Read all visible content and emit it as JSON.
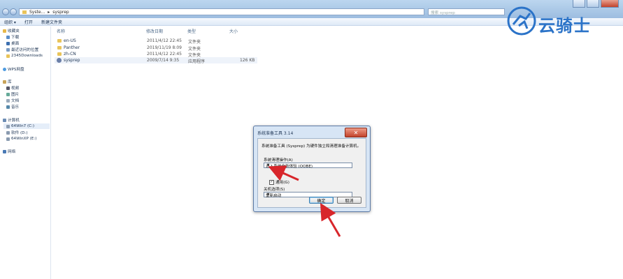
{
  "window": {
    "address": [
      "Syste...",
      "sysprep"
    ],
    "search_placeholder": "搜索 sysprep"
  },
  "toolbar": {
    "organize": "组织 ▾",
    "open": "打开",
    "new_folder": "新建文件夹"
  },
  "sidebar": {
    "items": [
      {
        "label": "收藏夹",
        "icon": "star-icon"
      },
      {
        "label": "下载",
        "icon": "download-folder-icon"
      },
      {
        "label": "桌面",
        "icon": "desktop-icon"
      },
      {
        "label": "最近访问的位置",
        "icon": "recent-places-icon"
      },
      {
        "label": "2345Downloads",
        "icon": "folder-icon"
      },
      {
        "label": "WPS网盘",
        "icon": "cloud-icon"
      },
      {
        "label": "库",
        "icon": "library-icon"
      },
      {
        "label": "视频",
        "icon": "video-icon"
      },
      {
        "label": "图片",
        "icon": "picture-icon"
      },
      {
        "label": "文档",
        "icon": "document-icon"
      },
      {
        "label": "音乐",
        "icon": "music-icon"
      },
      {
        "label": "计算机",
        "icon": "computer-icon"
      },
      {
        "label": "64Win7 (C:)",
        "icon": "drive-icon"
      },
      {
        "label": "软件 (D:)",
        "icon": "drive-icon"
      },
      {
        "label": "64WinXP (E:)",
        "icon": "drive-icon"
      },
      {
        "label": "网络",
        "icon": "network-icon"
      }
    ]
  },
  "filelist": {
    "columns": [
      "名称",
      "修改日期",
      "类型",
      "大小"
    ],
    "rows": [
      {
        "name": "en-US",
        "date": "2011/4/12 22:45",
        "type": "文件夹",
        "size": ""
      },
      {
        "name": "Panther",
        "date": "2019/11/19 8:09",
        "type": "文件夹",
        "size": ""
      },
      {
        "name": "zh-CN",
        "date": "2011/4/12 22:45",
        "type": "文件夹",
        "size": ""
      },
      {
        "name": "sysprep",
        "date": "2009/7/14 9:35",
        "type": "应用程序",
        "size": "126 KB"
      }
    ]
  },
  "dialog": {
    "title": "系统准备工具 3.14",
    "close": "✕",
    "description": "系统准备工具 (Sysprep) 为硬件独立和清理准备计算机。",
    "cleanup_label": "系统清理操作(A)",
    "cleanup_value": "进入系统全新体验 (OOBE)",
    "generalize_label": "通用(G)",
    "generalize_checked": "✓",
    "shutdown_label": "关机选项(S)",
    "shutdown_value": "重新启动",
    "ok": "确定",
    "cancel": "取消"
  },
  "watermark": {
    "text": "云骑士"
  },
  "colors": {
    "arrow": "#d8262b",
    "accent": "#2b73c8"
  }
}
